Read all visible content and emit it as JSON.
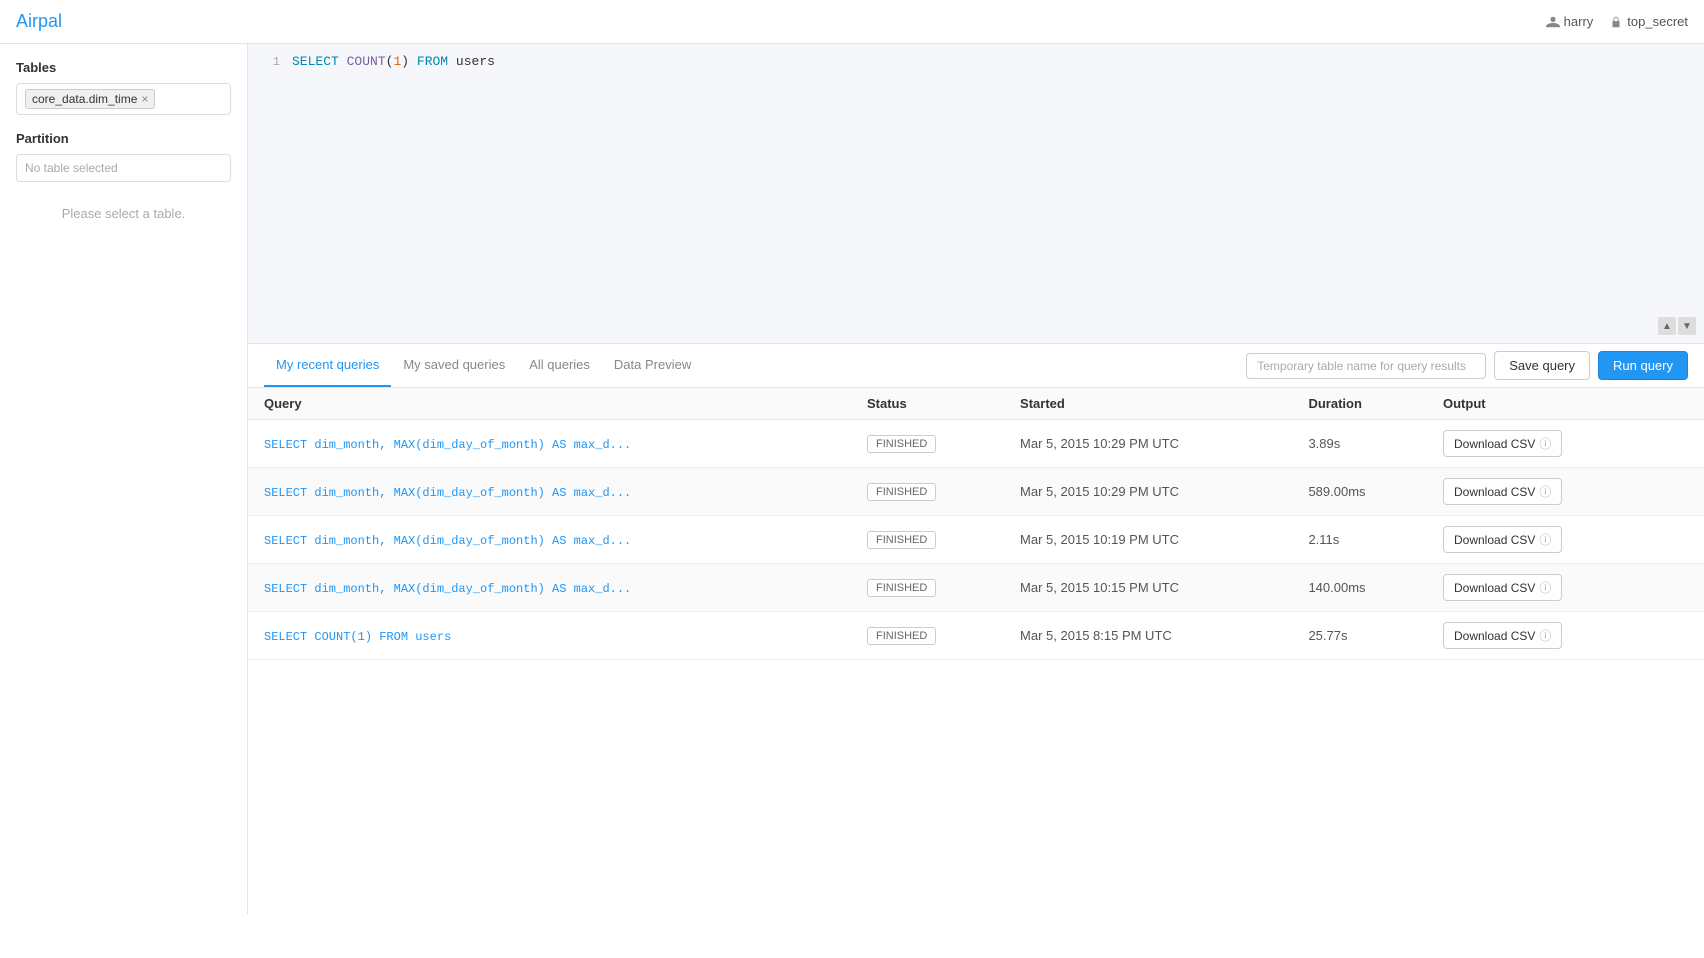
{
  "header": {
    "logo": "Airpal",
    "user": "harry",
    "schema": "top_secret"
  },
  "sidebar": {
    "tables_label": "Tables",
    "table_tag": "core_data.dim_time",
    "partition_label": "Partition",
    "partition_placeholder": "No table selected",
    "please_select": "Please select a table."
  },
  "editor": {
    "line1_number": "1",
    "line1_code": "SELECT COUNT(1) FROM users"
  },
  "tabs": [
    {
      "id": "recent",
      "label": "My recent queries",
      "active": true
    },
    {
      "id": "saved",
      "label": "My saved queries",
      "active": false
    },
    {
      "id": "all",
      "label": "All queries",
      "active": false
    },
    {
      "id": "preview",
      "label": "Data Preview",
      "active": false
    }
  ],
  "toolbar": {
    "temp_table_placeholder": "Temporary table name for query results",
    "save_query_label": "Save query",
    "run_query_label": "Run query"
  },
  "table_headers": {
    "query": "Query",
    "status": "Status",
    "started": "Started",
    "duration": "Duration",
    "output": "Output"
  },
  "rows": [
    {
      "query": "SELECT dim_month, MAX(dim_day_of_month) AS max_d...",
      "status": "FINISHED",
      "started": "Mar 5, 2015 10:29 PM UTC",
      "duration": "3.89s",
      "output": "Download CSV"
    },
    {
      "query": "SELECT dim_month, MAX(dim_day_of_month) AS max_d...",
      "status": "FINISHED",
      "started": "Mar 5, 2015 10:29 PM UTC",
      "duration": "589.00ms",
      "output": "Download CSV"
    },
    {
      "query": "SELECT dim_month, MAX(dim_day_of_month) AS max_d...",
      "status": "FINISHED",
      "started": "Mar 5, 2015 10:19 PM UTC",
      "duration": "2.11s",
      "output": "Download CSV"
    },
    {
      "query": "SELECT dim_month, MAX(dim_day_of_month) AS max_d...",
      "status": "FINISHED",
      "started": "Mar 5, 2015 10:15 PM UTC",
      "duration": "140.00ms",
      "output": "Download CSV"
    },
    {
      "query": "SELECT COUNT(1) FROM users",
      "status": "FINISHED",
      "started": "Mar 5, 2015 8:15 PM UTC",
      "duration": "25.77s",
      "output": "Download CSV"
    }
  ]
}
